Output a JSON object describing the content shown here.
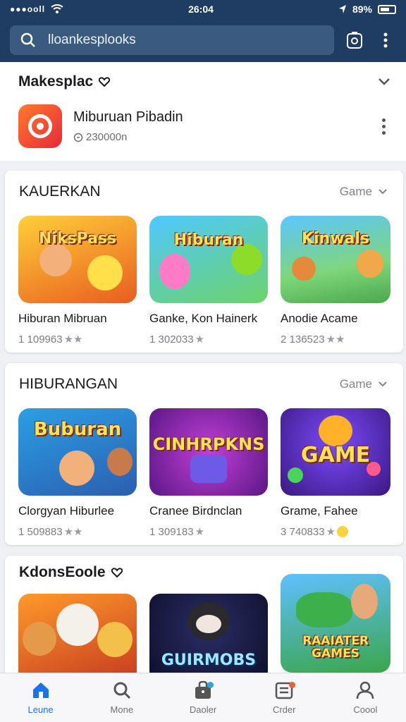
{
  "status_bar": {
    "time": "26:04",
    "battery": "89%"
  },
  "search": {
    "text": "lloankesplooks"
  },
  "marketplace": {
    "title": "Makesplac",
    "account_name": "Miburuan Pibadin",
    "account_sub": "230000n"
  },
  "sections": [
    {
      "title": "KAUERKAN",
      "see_more": "Game",
      "items": [
        {
          "name": "Hiburan Mibruan",
          "rating": "1 109963",
          "art": "NiksPass"
        },
        {
          "name": "Ganke, Kon Hainerk",
          "rating": "1 302033",
          "art": "Hiburan"
        },
        {
          "name": "Anodie Acame",
          "rating": "2 136523",
          "art": "Kinwals"
        }
      ]
    },
    {
      "title": "HIBURANGAN",
      "see_more": "Game",
      "items": [
        {
          "name": "Clorgyan Hiburlee",
          "rating": "1 509883",
          "art": "Buburan"
        },
        {
          "name": "Cranee Birdnclan",
          "rating": "1 309183",
          "art": "CINHRPKNS"
        },
        {
          "name": "Grame, Fahee",
          "rating": "3 740833",
          "art": "GAME"
        }
      ]
    },
    {
      "title": "KdonsEoole",
      "see_more": "",
      "items": [
        {
          "name": "",
          "rating": "",
          "art": ""
        },
        {
          "name": "",
          "rating": "",
          "art": "GUIRMOBS"
        },
        {
          "name": "",
          "rating": "",
          "art": "RAAIATER GAMES"
        }
      ]
    }
  ],
  "bottom_nav": [
    {
      "label": "Leune",
      "icon": "home-icon"
    },
    {
      "label": "Mone",
      "icon": "search-icon"
    },
    {
      "label": "Daoler",
      "icon": "bag-icon"
    },
    {
      "label": "Crder",
      "icon": "orders-icon"
    },
    {
      "label": "Coool",
      "icon": "profile-icon"
    }
  ],
  "colors": {
    "header": "#1f3d63",
    "active_nav": "#1a73e8",
    "app_icon": "#e8283a"
  }
}
